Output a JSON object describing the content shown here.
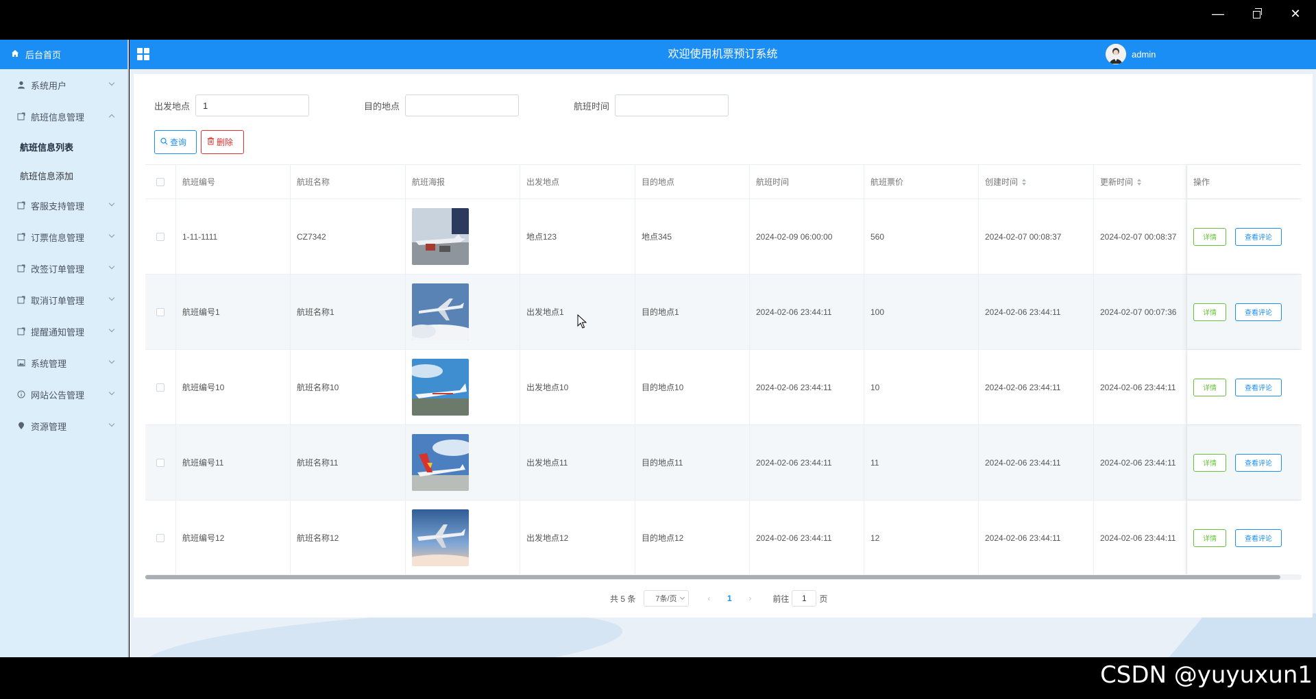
{
  "window": {
    "min_glyph": "—",
    "close_glyph": "✕"
  },
  "header": {
    "title": "欢迎使用机票预订系统",
    "username": "admin"
  },
  "sidebar": {
    "home": "后台首页",
    "items": [
      {
        "label": "系统用户",
        "icon": "user-icon",
        "expanded": false
      },
      {
        "label": "航班信息管理",
        "icon": "doc-icon",
        "expanded": true,
        "children": [
          "航班信息列表",
          "航班信息添加"
        ]
      },
      {
        "label": "客服支持管理",
        "icon": "doc-icon",
        "expanded": false
      },
      {
        "label": "订票信息管理",
        "icon": "doc-icon",
        "expanded": false
      },
      {
        "label": "改签订单管理",
        "icon": "doc-icon",
        "expanded": false
      },
      {
        "label": "取消订单管理",
        "icon": "doc-icon",
        "expanded": false
      },
      {
        "label": "提醒通知管理",
        "icon": "doc-icon",
        "expanded": false
      },
      {
        "label": "系统管理",
        "icon": "image-icon",
        "expanded": false
      },
      {
        "label": "网站公告管理",
        "icon": "info-icon",
        "expanded": false
      },
      {
        "label": "资源管理",
        "icon": "pin-icon",
        "expanded": false
      }
    ]
  },
  "search": {
    "from_label": "出发地点",
    "from_value": "1",
    "to_label": "目的地点",
    "to_value": "",
    "time_label": "航班时间",
    "time_value": ""
  },
  "buttons": {
    "query": "查询",
    "delete": "删除"
  },
  "table": {
    "headers": [
      "航班编号",
      "航班名称",
      "航班海报",
      "出发地点",
      "目的地点",
      "航班时间",
      "航班票价",
      "创建时间",
      "更新时间",
      "操作"
    ],
    "rows": [
      {
        "no": "1-11-1111",
        "name": "CZ7342",
        "poster": "airport-plane",
        "from": "地点123",
        "to": "地点345",
        "time": "2024-02-09 06:00:00",
        "price": "560",
        "created": "2024-02-07 00:08:37",
        "updated": "2024-02-07 00:08:37"
      },
      {
        "no": "航班编号1",
        "name": "航班名称1",
        "poster": "plane-clouds",
        "from": "出发地点1",
        "to": "目的地点1",
        "time": "2024-02-06 23:44:11",
        "price": "100",
        "created": "2024-02-06 23:44:11",
        "updated": "2024-02-07 00:07:36"
      },
      {
        "no": "航班编号10",
        "name": "航班名称10",
        "poster": "plane-runway",
        "from": "出发地点10",
        "to": "目的地点10",
        "time": "2024-02-06 23:44:11",
        "price": "10",
        "created": "2024-02-06 23:44:11",
        "updated": "2024-02-06 23:44:11"
      },
      {
        "no": "航班编号11",
        "name": "航班名称11",
        "poster": "plane-red-tail",
        "from": "出发地点11",
        "to": "目的地点11",
        "time": "2024-02-06 23:44:11",
        "price": "11",
        "created": "2024-02-06 23:44:11",
        "updated": "2024-02-06 23:44:11"
      },
      {
        "no": "航班编号12",
        "name": "航班名称12",
        "poster": "plane-sunset",
        "from": "出发地点12",
        "to": "目的地点12",
        "time": "2024-02-06 23:44:11",
        "price": "12",
        "created": "2024-02-06 23:44:11",
        "updated": "2024-02-06 23:44:11"
      }
    ],
    "op_detail": "详情",
    "op_review": "查看评论"
  },
  "pagination": {
    "total": "共 5 条",
    "page_size": "7条/页",
    "current": "1",
    "goto_prefix": "前往",
    "goto_value": "1",
    "goto_suffix": "页"
  },
  "watermark": "CSDN @yuyuxun1",
  "colors": {
    "primary": "#1b8ef5",
    "danger": "#e0302e",
    "success": "#67c23a",
    "sidebar_bg": "#ddeefb"
  }
}
